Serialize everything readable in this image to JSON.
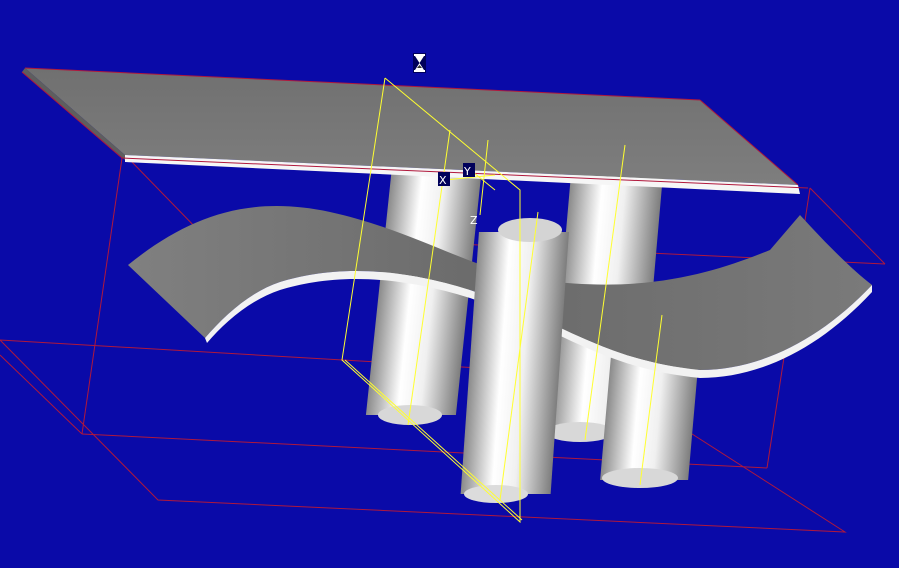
{
  "viewport": {
    "background_color": "#0a0aa8",
    "bbox_color": "#b0183c",
    "section_plane_color": "#ffff30",
    "surface_color": "#777777",
    "cylinder_light": "#ffffff",
    "cylinder_dark": "#8a8a8a"
  },
  "axes": {
    "x_label": "X",
    "y_label": "Y",
    "z_label": "Z"
  },
  "cursor": {
    "icon": "hourglass-icon",
    "state": "busy"
  }
}
